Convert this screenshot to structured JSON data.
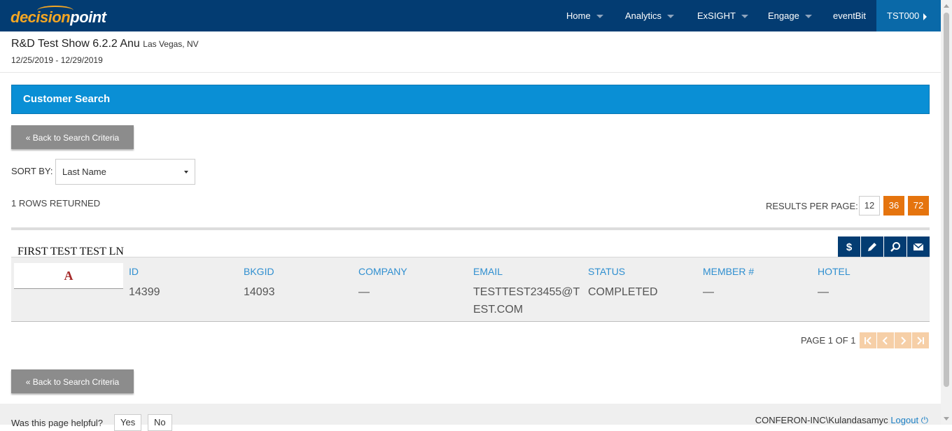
{
  "nav": {
    "logo_part1": "decision",
    "logo_part2": "point",
    "items": [
      {
        "label": "Home"
      },
      {
        "label": "Analytics"
      },
      {
        "label": "ExSIGHT"
      },
      {
        "label": "Engage"
      },
      {
        "label": "eventBit"
      }
    ],
    "active_item": "TST000"
  },
  "show": {
    "title": "R&D Test Show 6.2.2 Anu",
    "location": "Las Vegas, NV",
    "dates": "12/25/2019 - 12/29/2019"
  },
  "panel": {
    "title": "Customer Search"
  },
  "back_button_label": "« Back to Search Criteria",
  "sort": {
    "label": "SORT BY:",
    "selected": "Last Name"
  },
  "rows_returned": "1 ROWS RETURNED",
  "results_per_page": {
    "label": "RESULTS PER PAGE:",
    "options": [
      "12",
      "36",
      "72"
    ]
  },
  "result": {
    "name": "FIRST TEST TEST LN",
    "avatar_initial": "A",
    "actions": [
      "dollar-icon",
      "pencil-icon",
      "search-icon",
      "envelope-icon"
    ],
    "columns": [
      {
        "header": "ID",
        "value": "14399"
      },
      {
        "header": "BKGID",
        "value": "14093"
      },
      {
        "header": "COMPANY",
        "value": "—"
      },
      {
        "header": "EMAIL",
        "value": "TESTTEST23455@TEST.COM"
      },
      {
        "header": "STATUS",
        "value": "COMPLETED"
      },
      {
        "header": "MEMBER #",
        "value": "—"
      },
      {
        "header": "HOTEL",
        "value": "—"
      }
    ]
  },
  "pagination": {
    "label": "PAGE 1 OF 1"
  },
  "footer": {
    "helpful_question": "Was this page helpful?",
    "yes": "Yes",
    "no": "No",
    "user": "CONFERON-INC\\Kulandasamyc",
    "logout": "Logout"
  },
  "colors": {
    "nav_bg": "#033c72",
    "panel_bg": "#0a8fd5",
    "accent_orange": "#e5740e",
    "link_blue": "#2f8fd0"
  }
}
